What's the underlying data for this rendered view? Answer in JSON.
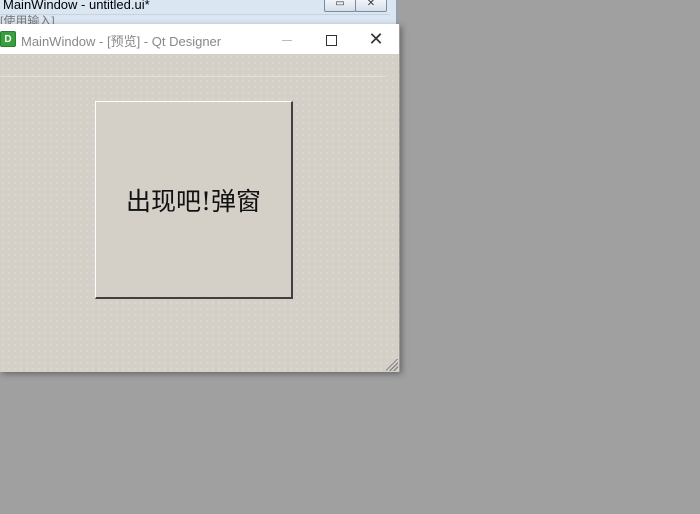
{
  "background_window": {
    "title": "MainWindow - untitled.ui*",
    "subtitle": "[使用输入]",
    "minimize_label": "▭",
    "close_label": "✕"
  },
  "preview_window": {
    "app_icon_letter": "D",
    "title": "MainWindow - [预览] - Qt Designer",
    "close_glyph": "✕"
  },
  "main": {
    "popup_button_label": "出现吧!弹窗"
  },
  "colors": {
    "desktop": "#a0a0a0",
    "window_face": "#d4d0c8",
    "titlebar": "#ffffff",
    "app_icon": "#37a03c"
  }
}
